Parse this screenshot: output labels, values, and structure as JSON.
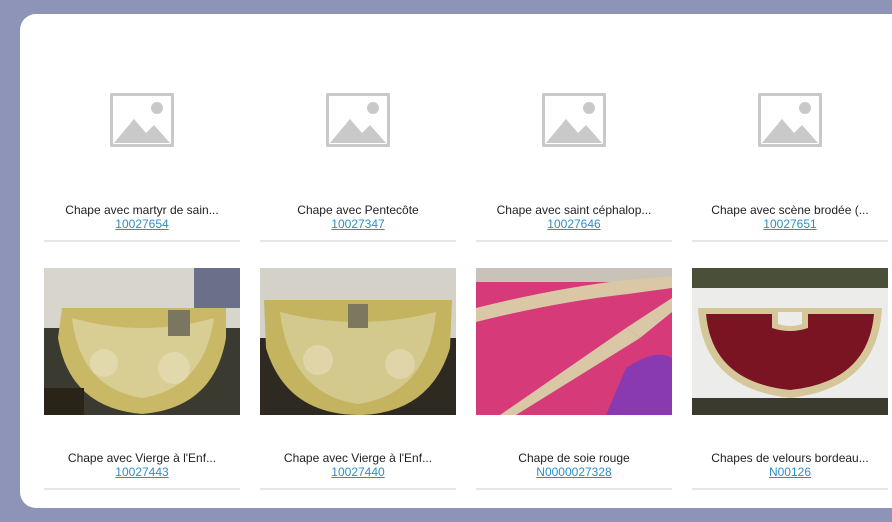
{
  "rows": [
    [
      {
        "title": "Chape avec martyr de sain...",
        "ref": "10027654",
        "image": "placeholder-image-icon"
      },
      {
        "title": "Chape avec Pentecôte",
        "ref": "10027347",
        "image": "placeholder-image-icon"
      },
      {
        "title": "Chape avec saint céphalop...",
        "ref": "10027646",
        "image": "placeholder-image-icon"
      },
      {
        "title": "Chape avec scène brodée (...",
        "ref": "10027651",
        "image": "placeholder-image-icon"
      }
    ],
    [
      {
        "title": "Chape avec Vierge à l'Enf...",
        "ref": "10027443",
        "image": "photo-gold-cope"
      },
      {
        "title": "Chape avec Vierge à l'Enf...",
        "ref": "10027440",
        "image": "photo-gold-cope"
      },
      {
        "title": "Chape de soie rouge",
        "ref": "N0000027328",
        "image": "photo-pink-silk"
      },
      {
        "title": "Chapes de velours bordeau...",
        "ref": "N00126",
        "image": "photo-burgundy-velvet"
      }
    ]
  ],
  "colors": {
    "background": "#8e94b8",
    "panel": "#ffffff",
    "link": "#2a8fc8",
    "placeholder": "#c9c9c9"
  }
}
